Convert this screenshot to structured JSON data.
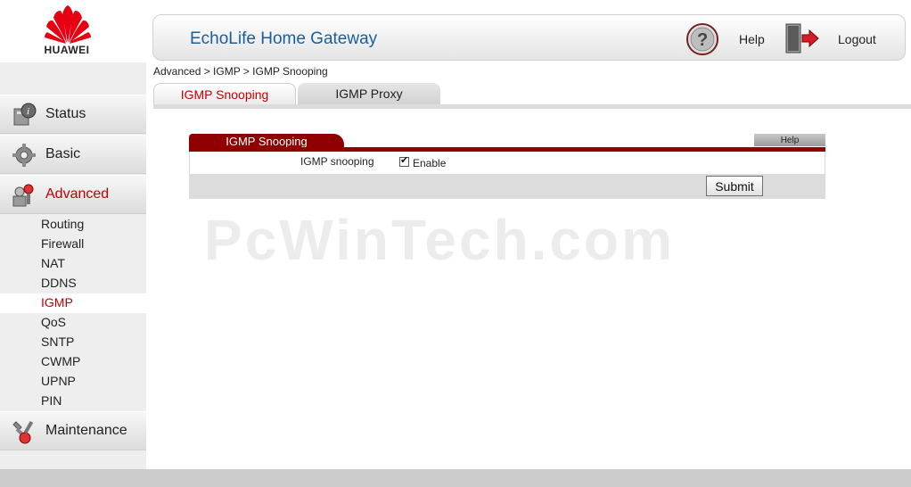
{
  "brand": {
    "logo_text": "HUAWEI"
  },
  "header": {
    "title": "EchoLife Home Gateway",
    "help_label": "Help",
    "logout_label": "Logout"
  },
  "breadcrumb": "Advanced > IGMP > IGMP Snooping",
  "tabs": [
    {
      "label": "IGMP Snooping",
      "active": true
    },
    {
      "label": "IGMP Proxy",
      "active": false
    }
  ],
  "sidebar": {
    "menu": [
      {
        "label": "Status",
        "icon": "status-icon"
      },
      {
        "label": "Basic",
        "icon": "gear-icon"
      },
      {
        "label": "Advanced",
        "icon": "advanced-icon",
        "active": true
      },
      {
        "label": "Maintenance",
        "icon": "maintenance-icon"
      }
    ],
    "submenu": [
      {
        "label": "Routing"
      },
      {
        "label": "Firewall"
      },
      {
        "label": "NAT"
      },
      {
        "label": "DDNS"
      },
      {
        "label": "IGMP",
        "active": true
      },
      {
        "label": "QoS"
      },
      {
        "label": "SNTP"
      },
      {
        "label": "CWMP"
      },
      {
        "label": "UPNP"
      },
      {
        "label": "PIN"
      }
    ]
  },
  "panel": {
    "title": "IGMP Snooping",
    "help_label": "Help",
    "field_label": "IGMP snooping",
    "checkbox_label": "Enable",
    "checkbox_checked": true,
    "checkbox_mark": "✔",
    "submit_label": "Submit"
  },
  "watermark": "PcWinTech.com",
  "colors": {
    "accent": "#c00000",
    "panel_header": "#900000",
    "title_blue": "#1a5f9c"
  }
}
